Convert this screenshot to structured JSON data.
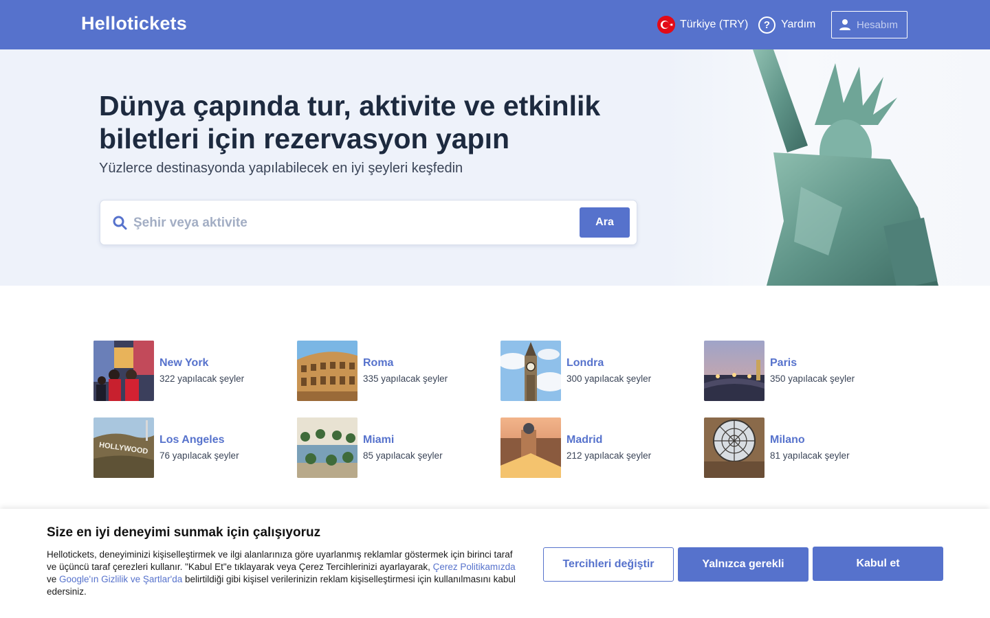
{
  "header": {
    "logo": "Hellotickets",
    "locale_label": "Türkiye (TRY)",
    "help_label": "Yardım",
    "account_label": "Hesabım"
  },
  "hero": {
    "title": "Dünya çapında tur, aktivite ve etkinlik biletleri için rezervasyon yapın",
    "subtitle": "Yüzlerce destinasyonda yapılabilecek en iyi şeyleri keşfedin",
    "search_placeholder": "Şehir veya aktivite",
    "search_button": "Ara"
  },
  "destinations": [
    {
      "name": "New York",
      "count": "322 yapılacak şeyler"
    },
    {
      "name": "Roma",
      "count": "335 yapılacak şeyler"
    },
    {
      "name": "Londra",
      "count": "300 yapılacak şeyler"
    },
    {
      "name": "Paris",
      "count": "350 yapılacak şeyler"
    },
    {
      "name": "Los Angeles",
      "count": "76 yapılacak şeyler"
    },
    {
      "name": "Miami",
      "count": "85 yapılacak şeyler"
    },
    {
      "name": "Madrid",
      "count": "212 yapılacak şeyler"
    },
    {
      "name": "Milano",
      "count": "81 yapılacak şeyler"
    }
  ],
  "cookie": {
    "title": "Size en iyi deneyimi sunmak için çalışıyoruz",
    "text_part1": "Hellotickets, deneyiminizi kişiselleştirmek ve ilgi alanlarınıza göre uyarlanmış reklamlar göstermek için birinci taraf ve üçüncü taraf çerezleri kullanır. \"Kabul Et\"e tıklayarak veya Çerez Tercihlerinizi ayarlayarak, ",
    "link1": "Çerez Politikamızda",
    "text_part2": " ve ",
    "link2": "Google'ın Gizlilik ve Şartlar'da",
    "text_part3": " belirtildiği gibi kişisel verilerinizin reklam kişiselleştirmesi için kullanılmasını kabul edersiniz.",
    "btn_preferences": "Tercihleri değiştir",
    "btn_necessary": "Yalnızca gerekli",
    "btn_accept": "Kabul et"
  },
  "colors": {
    "brand": "#5672cc",
    "hero_bg": "#eef2fa",
    "title": "#1d2a3f"
  }
}
